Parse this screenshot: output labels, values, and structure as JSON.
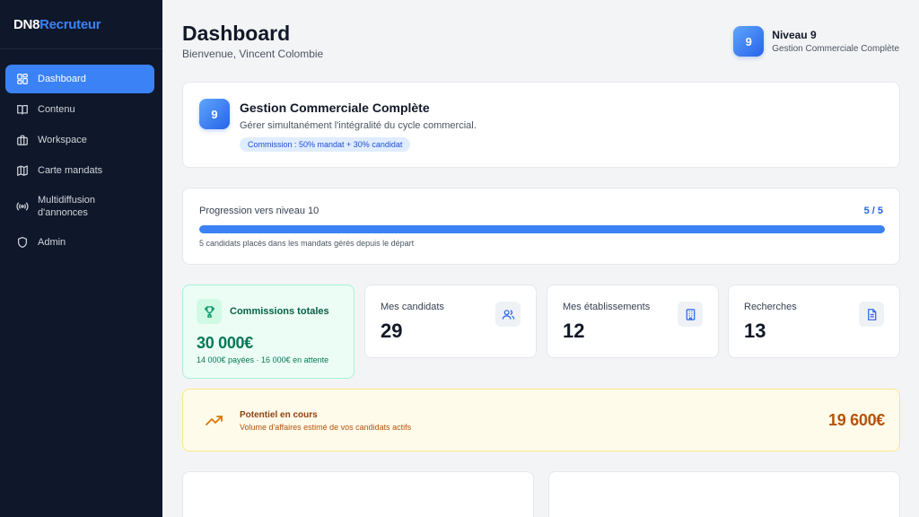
{
  "brand": {
    "part1": "DN8",
    "part2": "Recruteur"
  },
  "sidebar": {
    "items": [
      {
        "label": "Dashboard",
        "icon": "dashboard-icon"
      },
      {
        "label": "Contenu",
        "icon": "book-icon"
      },
      {
        "label": "Workspace",
        "icon": "briefcase-icon"
      },
      {
        "label": "Carte mandats",
        "icon": "map-icon"
      },
      {
        "label": "Multidiffusion d'annonces",
        "icon": "broadcast-icon"
      },
      {
        "label": "Admin",
        "icon": "shield-icon"
      }
    ]
  },
  "header": {
    "title": "Dashboard",
    "welcome": "Bienvenue, Vincent Colombie",
    "level_badge": "9",
    "level_name": "Niveau 9",
    "level_sub": "Gestion Commerciale Complète"
  },
  "level_card": {
    "badge": "9",
    "title": "Gestion Commerciale Complète",
    "description": "Gérer simultanément l'intégralité du cycle commercial.",
    "commission_pill": "Commission : 50% mandat + 30% candidat"
  },
  "progress": {
    "label": "Progression vers niveau 10",
    "count": "5 / 5",
    "fraction": 1.0,
    "note": "5 candidats placés dans les mandats gérés depuis le départ"
  },
  "stats": {
    "commissions": {
      "label": "Commissions totales",
      "value": "30 000€",
      "sub": "14 000€ payées · 16 000€ en attente"
    },
    "candidats": {
      "label": "Mes candidats",
      "value": "29"
    },
    "etablissements": {
      "label": "Mes établissements",
      "value": "12"
    },
    "recherches": {
      "label": "Recherches",
      "value": "13"
    }
  },
  "potential": {
    "title": "Potentiel en cours",
    "subtitle": "Volume d'affaires estimé de vos candidats actifs",
    "value": "19 600€"
  },
  "colors": {
    "sidebar_bg": "#0f172a",
    "accent": "#3b82f6",
    "success": "#047857",
    "warning": "#b45309"
  }
}
